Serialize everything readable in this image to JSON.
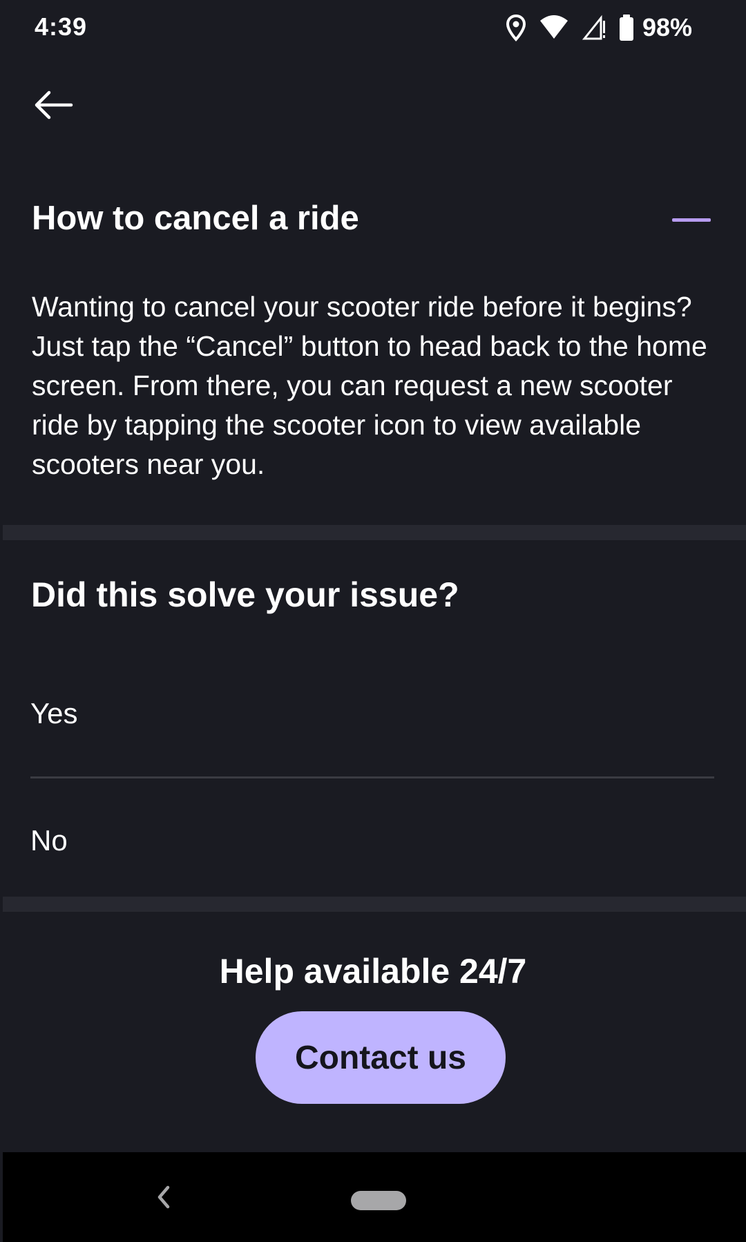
{
  "status_bar": {
    "time": "4:39",
    "battery_percent": "98%",
    "icons": [
      "location-icon",
      "wifi-icon",
      "cellular-signal-icon",
      "battery-icon"
    ]
  },
  "header": {
    "back_icon": "arrow-left-icon"
  },
  "article": {
    "title": "How to cancel a ride",
    "toggle_icon": "minus-icon",
    "body": "Wanting to cancel your scooter ride before it begins? Just tap the “Cancel” button to head back to the home screen. From there, you can request a new scooter ride by tapping the scooter icon to view available scooters near you."
  },
  "feedback": {
    "question": "Did this solve your issue?",
    "options": [
      "Yes",
      "No"
    ]
  },
  "help": {
    "title": "Help available 24/7",
    "contact_label": "Contact us"
  },
  "nav_bar": {
    "back_icon": "chevron-left-icon",
    "home_icon": "home-pill-icon"
  },
  "colors": {
    "background": "#1a1b22",
    "separator": "#272830",
    "accent": "#b79cf0",
    "button": "#bfb4ff",
    "button_text": "#15151c"
  }
}
